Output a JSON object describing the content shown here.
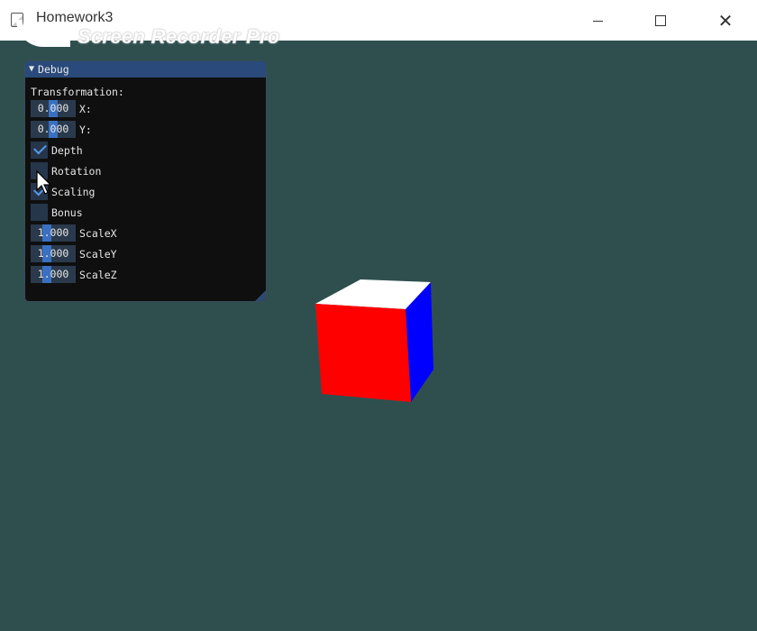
{
  "window": {
    "title": "Homework3",
    "watermark": "Screen Recorder Pro"
  },
  "debug_panel": {
    "title": "Debug",
    "section_label": "Transformation:",
    "fields": [
      {
        "value": "0.000",
        "label": "X:"
      },
      {
        "value": "0.000",
        "label": "Y:"
      }
    ],
    "checkboxes": [
      {
        "label": "Depth",
        "checked": true
      },
      {
        "label": "Rotation",
        "checked": false
      },
      {
        "label": "Scaling",
        "checked": true
      },
      {
        "label": "Bonus",
        "checked": false
      }
    ],
    "scales": [
      {
        "value": "1.000",
        "label": "ScaleX"
      },
      {
        "value": "1.000",
        "label": "ScaleY"
      },
      {
        "value": "1.000",
        "label": "ScaleZ"
      }
    ]
  },
  "colors": {
    "background": "#2f4f4f",
    "cube_front": "#ff0000",
    "cube_right": "#0000ff",
    "cube_top": "#ffffff"
  }
}
